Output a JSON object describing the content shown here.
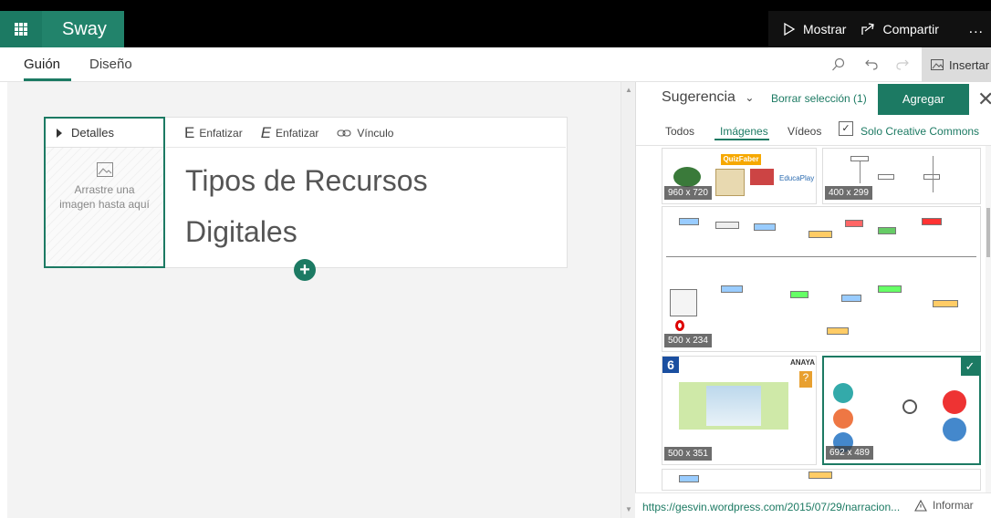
{
  "app": {
    "name": "Sway"
  },
  "topbar": {
    "show_label": "Mostrar",
    "share_label": "Compartir",
    "more_label": "..."
  },
  "tabs": [
    {
      "label": "Guión",
      "active": true
    },
    {
      "label": "Diseño",
      "active": false
    }
  ],
  "toolbar": {
    "insert_label": "Insertar"
  },
  "card": {
    "details_label": "Detalles",
    "drop_hint": "Arrastre una imagen hasta aquí",
    "format": {
      "emphasis1": "Enfatizar",
      "emphasis2": "Enfatizar",
      "link": "Vínculo"
    },
    "title_line1": "Tipos de Recursos",
    "title_line2": "Digitales",
    "add_symbol": "+"
  },
  "pane": {
    "suggestion_label": "Sugerencia",
    "clear_selection": "Borrar selección (1)",
    "add_button": "Agregar",
    "close_symbol": "✕",
    "tabs": [
      {
        "label": "Todos",
        "active": false
      },
      {
        "label": "Imágenes",
        "active": true
      },
      {
        "label": "Vídeos",
        "active": false
      }
    ],
    "creative_commons": {
      "label": "Solo Creative Commons",
      "checked": true,
      "check_symbol": "✓"
    },
    "thumbnails": [
      {
        "size": "960 x 720",
        "logos": [
          "QuizFaber",
          "EducaPlay"
        ]
      },
      {
        "size": "400 x 299",
        "selected": false
      },
      {
        "size": "500 x 234",
        "selected": false
      },
      {
        "size": "500 x 351",
        "selected": false,
        "header": "ANAYA"
      },
      {
        "size": "692 x 489",
        "selected": true
      }
    ],
    "selected_check": "✓"
  },
  "status": {
    "url": "https://gesvin.wordpress.com/2015/07/29/narracion...",
    "report_label": "Informar"
  },
  "colors": {
    "accent": "#1c7a63",
    "topbar": "#000000"
  }
}
